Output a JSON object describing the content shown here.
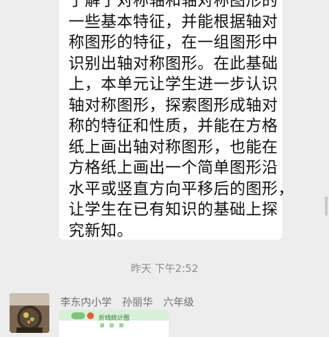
{
  "message": {
    "lines": [
      "了解了对称轴和轴对称图形的",
      "一些基本特征，并能根据轴对",
      "称图形的特征，在一组图形中",
      "识别出轴对称图形。在此基础",
      "上，本单元让学生进一步认识",
      "轴对称图形，探索图形成轴对",
      "称的特征和性质，并能在方格",
      "纸上画出轴对称图形，也能在",
      "方格纸上画出一个简单图形沿",
      "水平或竖直方向平移后的图形，",
      "让学生在已有知识的基础上探",
      "究新知。"
    ]
  },
  "timestamp": "昨天 下午2:52",
  "next_message": {
    "sender": "李东内小学　孙丽华　六年级",
    "card_title": "折线统计图"
  },
  "colors": {
    "background": "#ededed",
    "bubble": "#ffffff",
    "card_accent": "#2d7a2d"
  }
}
